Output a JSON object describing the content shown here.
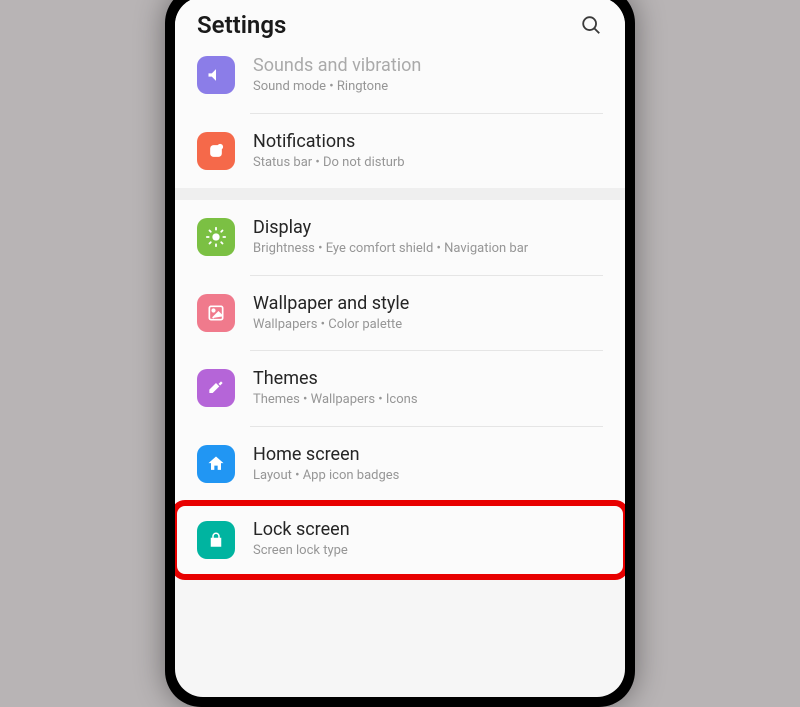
{
  "header": {
    "title": "Settings"
  },
  "items": {
    "sounds": {
      "title": "Sounds and vibration",
      "subtitle": "Sound mode • Ringtone"
    },
    "notifications": {
      "title": "Notifications",
      "subtitle": "Status bar • Do not disturb"
    },
    "display": {
      "title": "Display",
      "subtitle": "Brightness • Eye comfort shield • Navigation bar"
    },
    "wallpaper": {
      "title": "Wallpaper and style",
      "subtitle": "Wallpapers • Color palette"
    },
    "themes": {
      "title": "Themes",
      "subtitle": "Themes • Wallpapers • Icons"
    },
    "home": {
      "title": "Home screen",
      "subtitle": "Layout • App icon badges"
    },
    "lock": {
      "title": "Lock screen",
      "subtitle": "Screen lock type"
    }
  }
}
